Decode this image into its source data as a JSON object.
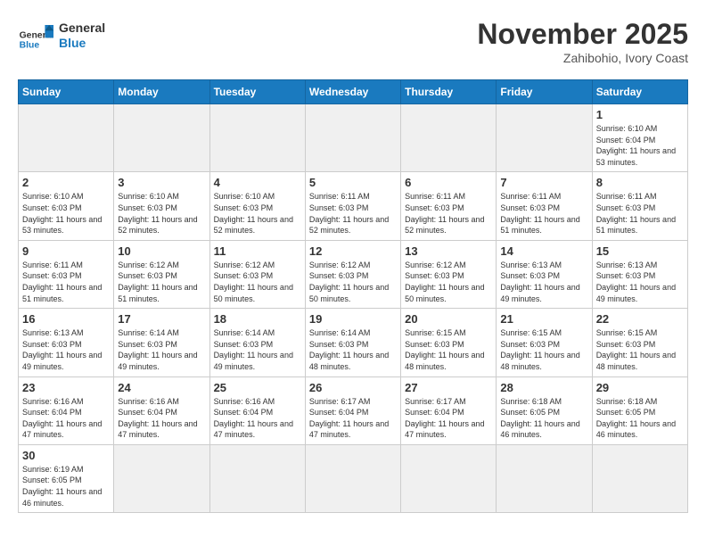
{
  "header": {
    "logo_general": "General",
    "logo_blue": "Blue",
    "month_title": "November 2025",
    "location": "Zahibohio, Ivory Coast"
  },
  "days_of_week": [
    "Sunday",
    "Monday",
    "Tuesday",
    "Wednesday",
    "Thursday",
    "Friday",
    "Saturday"
  ],
  "weeks": [
    [
      {
        "day": "",
        "empty": true
      },
      {
        "day": "",
        "empty": true
      },
      {
        "day": "",
        "empty": true
      },
      {
        "day": "",
        "empty": true
      },
      {
        "day": "",
        "empty": true
      },
      {
        "day": "",
        "empty": true
      },
      {
        "day": "1",
        "sunrise": "Sunrise: 6:10 AM",
        "sunset": "Sunset: 6:04 PM",
        "daylight": "Daylight: 11 hours and 53 minutes."
      }
    ],
    [
      {
        "day": "2",
        "sunrise": "Sunrise: 6:10 AM",
        "sunset": "Sunset: 6:03 PM",
        "daylight": "Daylight: 11 hours and 53 minutes."
      },
      {
        "day": "3",
        "sunrise": "Sunrise: 6:10 AM",
        "sunset": "Sunset: 6:03 PM",
        "daylight": "Daylight: 11 hours and 52 minutes."
      },
      {
        "day": "4",
        "sunrise": "Sunrise: 6:10 AM",
        "sunset": "Sunset: 6:03 PM",
        "daylight": "Daylight: 11 hours and 52 minutes."
      },
      {
        "day": "5",
        "sunrise": "Sunrise: 6:11 AM",
        "sunset": "Sunset: 6:03 PM",
        "daylight": "Daylight: 11 hours and 52 minutes."
      },
      {
        "day": "6",
        "sunrise": "Sunrise: 6:11 AM",
        "sunset": "Sunset: 6:03 PM",
        "daylight": "Daylight: 11 hours and 52 minutes."
      },
      {
        "day": "7",
        "sunrise": "Sunrise: 6:11 AM",
        "sunset": "Sunset: 6:03 PM",
        "daylight": "Daylight: 11 hours and 51 minutes."
      },
      {
        "day": "8",
        "sunrise": "Sunrise: 6:11 AM",
        "sunset": "Sunset: 6:03 PM",
        "daylight": "Daylight: 11 hours and 51 minutes."
      }
    ],
    [
      {
        "day": "9",
        "sunrise": "Sunrise: 6:11 AM",
        "sunset": "Sunset: 6:03 PM",
        "daylight": "Daylight: 11 hours and 51 minutes."
      },
      {
        "day": "10",
        "sunrise": "Sunrise: 6:12 AM",
        "sunset": "Sunset: 6:03 PM",
        "daylight": "Daylight: 11 hours and 51 minutes."
      },
      {
        "day": "11",
        "sunrise": "Sunrise: 6:12 AM",
        "sunset": "Sunset: 6:03 PM",
        "daylight": "Daylight: 11 hours and 50 minutes."
      },
      {
        "day": "12",
        "sunrise": "Sunrise: 6:12 AM",
        "sunset": "Sunset: 6:03 PM",
        "daylight": "Daylight: 11 hours and 50 minutes."
      },
      {
        "day": "13",
        "sunrise": "Sunrise: 6:12 AM",
        "sunset": "Sunset: 6:03 PM",
        "daylight": "Daylight: 11 hours and 50 minutes."
      },
      {
        "day": "14",
        "sunrise": "Sunrise: 6:13 AM",
        "sunset": "Sunset: 6:03 PM",
        "daylight": "Daylight: 11 hours and 49 minutes."
      },
      {
        "day": "15",
        "sunrise": "Sunrise: 6:13 AM",
        "sunset": "Sunset: 6:03 PM",
        "daylight": "Daylight: 11 hours and 49 minutes."
      }
    ],
    [
      {
        "day": "16",
        "sunrise": "Sunrise: 6:13 AM",
        "sunset": "Sunset: 6:03 PM",
        "daylight": "Daylight: 11 hours and 49 minutes."
      },
      {
        "day": "17",
        "sunrise": "Sunrise: 6:14 AM",
        "sunset": "Sunset: 6:03 PM",
        "daylight": "Daylight: 11 hours and 49 minutes."
      },
      {
        "day": "18",
        "sunrise": "Sunrise: 6:14 AM",
        "sunset": "Sunset: 6:03 PM",
        "daylight": "Daylight: 11 hours and 49 minutes."
      },
      {
        "day": "19",
        "sunrise": "Sunrise: 6:14 AM",
        "sunset": "Sunset: 6:03 PM",
        "daylight": "Daylight: 11 hours and 48 minutes."
      },
      {
        "day": "20",
        "sunrise": "Sunrise: 6:15 AM",
        "sunset": "Sunset: 6:03 PM",
        "daylight": "Daylight: 11 hours and 48 minutes."
      },
      {
        "day": "21",
        "sunrise": "Sunrise: 6:15 AM",
        "sunset": "Sunset: 6:03 PM",
        "daylight": "Daylight: 11 hours and 48 minutes."
      },
      {
        "day": "22",
        "sunrise": "Sunrise: 6:15 AM",
        "sunset": "Sunset: 6:03 PM",
        "daylight": "Daylight: 11 hours and 48 minutes."
      }
    ],
    [
      {
        "day": "23",
        "sunrise": "Sunrise: 6:16 AM",
        "sunset": "Sunset: 6:04 PM",
        "daylight": "Daylight: 11 hours and 47 minutes."
      },
      {
        "day": "24",
        "sunrise": "Sunrise: 6:16 AM",
        "sunset": "Sunset: 6:04 PM",
        "daylight": "Daylight: 11 hours and 47 minutes."
      },
      {
        "day": "25",
        "sunrise": "Sunrise: 6:16 AM",
        "sunset": "Sunset: 6:04 PM",
        "daylight": "Daylight: 11 hours and 47 minutes."
      },
      {
        "day": "26",
        "sunrise": "Sunrise: 6:17 AM",
        "sunset": "Sunset: 6:04 PM",
        "daylight": "Daylight: 11 hours and 47 minutes."
      },
      {
        "day": "27",
        "sunrise": "Sunrise: 6:17 AM",
        "sunset": "Sunset: 6:04 PM",
        "daylight": "Daylight: 11 hours and 47 minutes."
      },
      {
        "day": "28",
        "sunrise": "Sunrise: 6:18 AM",
        "sunset": "Sunset: 6:05 PM",
        "daylight": "Daylight: 11 hours and 46 minutes."
      },
      {
        "day": "29",
        "sunrise": "Sunrise: 6:18 AM",
        "sunset": "Sunset: 6:05 PM",
        "daylight": "Daylight: 11 hours and 46 minutes."
      }
    ],
    [
      {
        "day": "30",
        "sunrise": "Sunrise: 6:19 AM",
        "sunset": "Sunset: 6:05 PM",
        "daylight": "Daylight: 11 hours and 46 minutes."
      },
      {
        "day": "",
        "empty": true
      },
      {
        "day": "",
        "empty": true
      },
      {
        "day": "",
        "empty": true
      },
      {
        "day": "",
        "empty": true
      },
      {
        "day": "",
        "empty": true
      },
      {
        "day": "",
        "empty": true
      }
    ]
  ]
}
